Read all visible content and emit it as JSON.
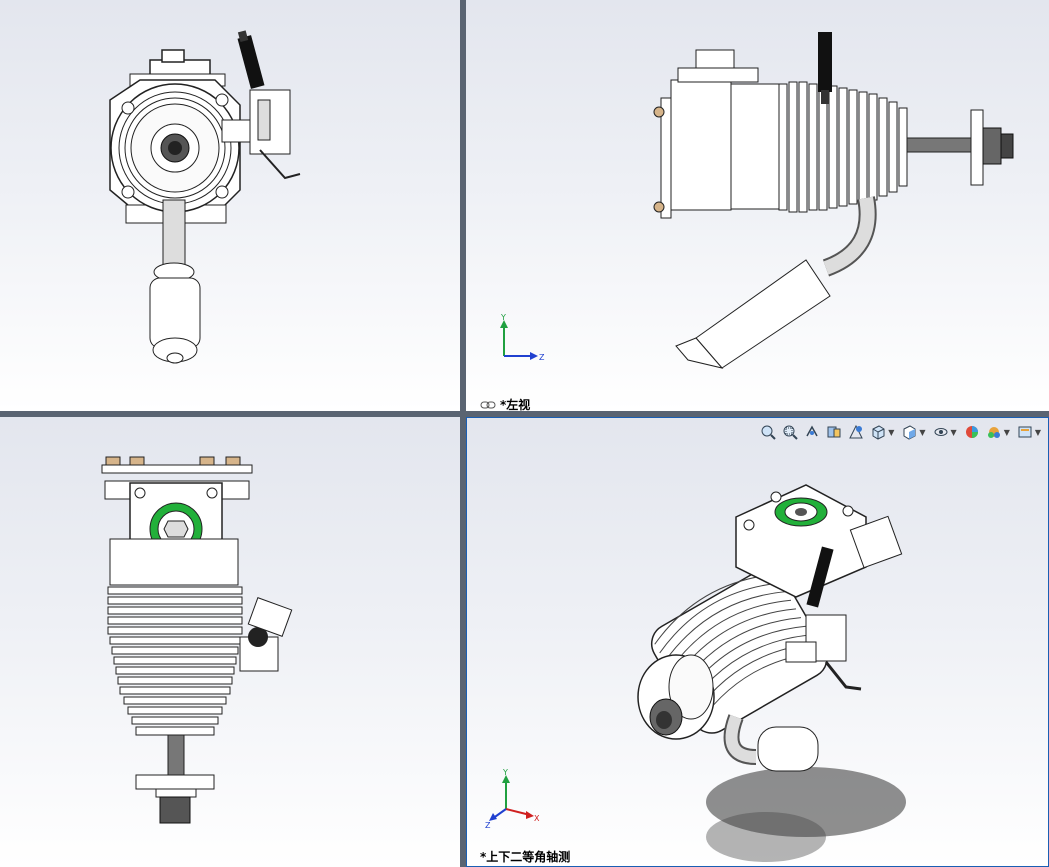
{
  "viewports": {
    "top_left": {
      "label": ""
    },
    "top_right": {
      "label": "*左视",
      "triad": {
        "y": "Y",
        "z": "Z"
      }
    },
    "bottom_left": {
      "label": ""
    },
    "bottom_right": {
      "label": "*上下二等角轴测",
      "triad": {
        "x": "X",
        "y": "Y",
        "z": "Z"
      }
    }
  },
  "heads_up_toolbar": {
    "items": [
      {
        "icon": "zoom-to-fit-icon"
      },
      {
        "icon": "zoom-to-area-icon"
      },
      {
        "icon": "previous-view-icon"
      },
      {
        "icon": "section-view-icon"
      },
      {
        "icon": "dynamic-annotation-icon"
      },
      {
        "icon": "view-orientation-icon",
        "dropdown": true
      },
      {
        "icon": "display-style-icon",
        "dropdown": true
      },
      {
        "icon": "hide-show-items-icon",
        "dropdown": true
      },
      {
        "icon": "edit-appearance-icon"
      },
      {
        "icon": "apply-scene-icon",
        "dropdown": true
      },
      {
        "icon": "view-settings-icon",
        "dropdown": true
      }
    ]
  },
  "colors": {
    "viewport_bg_top": "#e3e6ee",
    "viewport_bg_bottom": "#ffffff",
    "splitter": "#5a6472",
    "axis_x": "#d02020",
    "axis_y": "#20a040",
    "axis_z": "#2040d0",
    "accent_green": "#22b03a"
  }
}
